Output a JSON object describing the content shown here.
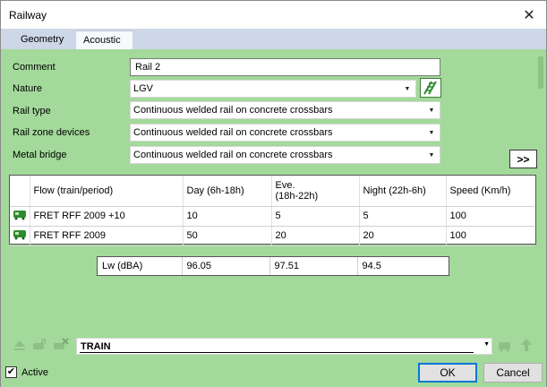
{
  "window": {
    "title": "Railway"
  },
  "tabs": [
    {
      "label": "Geometry"
    },
    {
      "label": "Acoustic"
    }
  ],
  "form": {
    "comment_label": "Comment",
    "comment_value": "Rail 2",
    "nature_label": "Nature",
    "nature_value": "LGV",
    "rail_type_label": "Rail type",
    "rail_type_value": "Continuous welded rail on concrete crossbars",
    "rail_zone_label": "Rail zone devices",
    "rail_zone_value": "Continuous welded rail on concrete crossbars",
    "metal_bridge_label": "Metal bridge",
    "metal_bridge_value": "Continuous welded rail on concrete crossbars",
    "more_button": ">>"
  },
  "grid": {
    "headers": {
      "flow": "Flow (train/period)",
      "day": "Day (6h-18h)",
      "eve_1": "Eve.",
      "eve_2": "(18h-22h)",
      "night": "Night (22h-6h)",
      "speed": "Speed (Km/h)"
    },
    "rows": [
      {
        "flow": "FRET RFF 2009 +10",
        "day": "10",
        "eve": "5",
        "night": "5",
        "speed": "100"
      },
      {
        "flow": "FRET RFF 2009",
        "day": "50",
        "eve": "20",
        "night": "20",
        "speed": "100"
      }
    ]
  },
  "lw": {
    "label": "Lw (dBA)",
    "values": [
      "96.05",
      "97.51",
      "94.5"
    ]
  },
  "train_selector": {
    "value": "TRAIN"
  },
  "footer": {
    "active_label": "Active",
    "active_checked": true,
    "ok": "OK",
    "cancel": "Cancel"
  },
  "colors": {
    "panel": "#a3d99b",
    "tab_strip": "#cdd7e8",
    "icon_green": "#2e8b2e"
  }
}
